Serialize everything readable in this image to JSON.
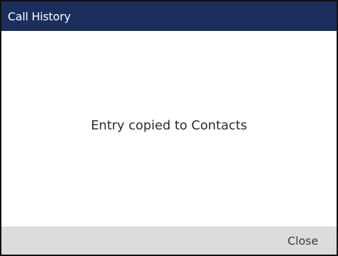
{
  "header": {
    "title": "Call History"
  },
  "dialog": {
    "message": "Entry copied to Contacts"
  },
  "softkeys": {
    "close_label": "Close"
  },
  "colors": {
    "title_bar": "#1b2e5c",
    "softkey_bar": "#dcdcdc",
    "border": "#111111"
  }
}
